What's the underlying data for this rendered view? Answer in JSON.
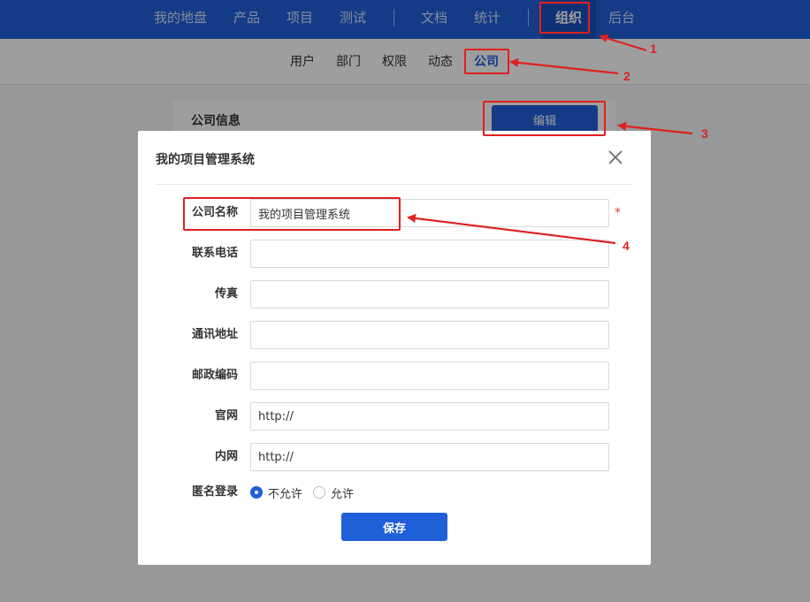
{
  "topnav": {
    "items": [
      "我的地盘",
      "产品",
      "项目",
      "测试",
      "文档",
      "统计",
      "组织",
      "后台"
    ],
    "active_index": 6
  },
  "subnav": {
    "items": [
      "用户",
      "部门",
      "权限",
      "动态",
      "公司"
    ],
    "active_index": 4
  },
  "panel": {
    "title": "公司信息",
    "edit_label": "编辑"
  },
  "modal": {
    "title": "我的项目管理系统",
    "fields": [
      {
        "label": "公司名称",
        "value": "我的项目管理系统",
        "required": "*"
      },
      {
        "label": "联系电话",
        "value": ""
      },
      {
        "label": "传真",
        "value": ""
      },
      {
        "label": "通讯地址",
        "value": ""
      },
      {
        "label": "邮政编码",
        "value": ""
      },
      {
        "label": "官网",
        "value": "http://"
      },
      {
        "label": "内网",
        "value": "http://"
      }
    ],
    "anonymous": {
      "label": "匿名登录",
      "options": [
        "不允许",
        "允许"
      ],
      "selected": "不允许"
    },
    "save_label": "保存"
  },
  "annotations": {
    "numbers": [
      "1",
      "2",
      "3",
      "4"
    ],
    "color": "#e02020"
  },
  "colors": {
    "primary": "#1f5fd8",
    "nav_bg": "#1f5fd8",
    "required": "#e53935"
  }
}
